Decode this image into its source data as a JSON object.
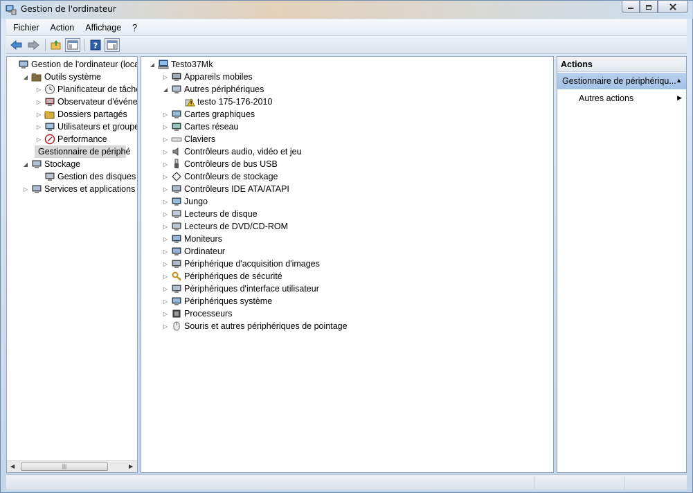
{
  "window": {
    "title": "Gestion de l'ordinateur"
  },
  "menu": [
    "Fichier",
    "Action",
    "Affichage",
    "?"
  ],
  "left_tree": [
    {
      "label": "Gestion de l'ordinateur (local)",
      "level": 0,
      "expander": "",
      "icon": "computer-management-icon"
    },
    {
      "label": "Outils système",
      "level": 1,
      "expander": "expanded",
      "icon": "tools-icon"
    },
    {
      "label": "Planificateur de tâches",
      "level": 2,
      "expander": "collapsed",
      "icon": "clock-icon"
    },
    {
      "label": "Observateur d'événeme",
      "level": 2,
      "expander": "collapsed",
      "icon": "event-viewer-icon"
    },
    {
      "label": "Dossiers partagés",
      "level": 2,
      "expander": "collapsed",
      "icon": "shared-folder-icon"
    },
    {
      "label": "Utilisateurs et groupes l",
      "level": 2,
      "expander": "collapsed",
      "icon": "users-icon"
    },
    {
      "label": "Performance",
      "level": 2,
      "expander": "collapsed",
      "icon": "performance-icon"
    },
    {
      "label": "Gestionnaire de périphé",
      "level": 2,
      "expander": "",
      "icon": "device-manager-icon",
      "selected": true
    },
    {
      "label": "Stockage",
      "level": 1,
      "expander": "expanded",
      "icon": "storage-icon"
    },
    {
      "label": "Gestion des disques",
      "level": 2,
      "expander": "",
      "icon": "disk-icon"
    },
    {
      "label": "Services et applications",
      "level": 1,
      "expander": "collapsed",
      "icon": "services-icon"
    }
  ],
  "device_tree": {
    "root": "Testo37Mk",
    "items": [
      {
        "label": "Appareils mobiles",
        "level": 1,
        "expander": "collapsed",
        "icon": "mobile-device-icon"
      },
      {
        "label": "Autres périphériques",
        "level": 1,
        "expander": "expanded",
        "icon": "unknown-device-icon"
      },
      {
        "label": "testo 175-176-2010",
        "level": 2,
        "expander": "",
        "icon": "warning-device-icon"
      },
      {
        "label": "Cartes graphiques",
        "level": 1,
        "expander": "collapsed",
        "icon": "display-adapter-icon"
      },
      {
        "label": "Cartes réseau",
        "level": 1,
        "expander": "collapsed",
        "icon": "network-adapter-icon"
      },
      {
        "label": "Claviers",
        "level": 1,
        "expander": "collapsed",
        "icon": "keyboard-icon"
      },
      {
        "label": "Contrôleurs audio, vidéo et jeu",
        "level": 1,
        "expander": "collapsed",
        "icon": "speaker-icon"
      },
      {
        "label": "Contrôleurs de bus USB",
        "level": 1,
        "expander": "collapsed",
        "icon": "usb-icon"
      },
      {
        "label": "Contrôleurs de stockage",
        "level": 1,
        "expander": "collapsed",
        "icon": "storage-controller-icon"
      },
      {
        "label": "Contrôleurs IDE ATA/ATAPI",
        "level": 1,
        "expander": "collapsed",
        "icon": "ide-icon"
      },
      {
        "label": "Jungo",
        "level": 1,
        "expander": "collapsed",
        "icon": "jungo-icon"
      },
      {
        "label": "Lecteurs de disque",
        "level": 1,
        "expander": "collapsed",
        "icon": "disk-drive-icon"
      },
      {
        "label": "Lecteurs de DVD/CD-ROM",
        "level": 1,
        "expander": "collapsed",
        "icon": "dvd-icon"
      },
      {
        "label": "Moniteurs",
        "level": 1,
        "expander": "collapsed",
        "icon": "monitor-icon"
      },
      {
        "label": "Ordinateur",
        "level": 1,
        "expander": "collapsed",
        "icon": "computer-icon"
      },
      {
        "label": "Périphérique d'acquisition d'images",
        "level": 1,
        "expander": "collapsed",
        "icon": "camera-icon"
      },
      {
        "label": "Périphériques de sécurité",
        "level": 1,
        "expander": "collapsed",
        "icon": "key-icon"
      },
      {
        "label": "Périphériques d'interface utilisateur",
        "level": 1,
        "expander": "collapsed",
        "icon": "hid-icon"
      },
      {
        "label": "Périphériques système",
        "level": 1,
        "expander": "collapsed",
        "icon": "system-device-icon"
      },
      {
        "label": "Processeurs",
        "level": 1,
        "expander": "collapsed",
        "icon": "processor-icon"
      },
      {
        "label": "Souris et autres périphériques de pointage",
        "level": 1,
        "expander": "collapsed",
        "icon": "mouse-icon"
      }
    ]
  },
  "actions": {
    "title": "Actions",
    "section": "Gestionnaire de périphériqu...",
    "item": "Autres actions"
  },
  "colors": {
    "selection": "#d9d9d9",
    "actions_section": "#b8d0ec",
    "frame": "#dfe9f5"
  }
}
